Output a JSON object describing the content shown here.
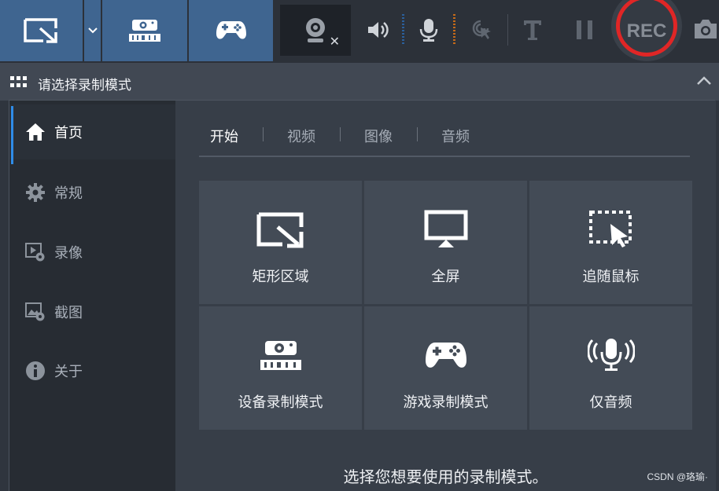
{
  "toolbar": {
    "rec_label": "REC"
  },
  "header": {
    "title": "请选择录制模式"
  },
  "sidebar": {
    "items": [
      {
        "label": "首页",
        "icon": "home-icon"
      },
      {
        "label": "常规",
        "icon": "gear-icon"
      },
      {
        "label": "录像",
        "icon": "video-settings-icon"
      },
      {
        "label": "截图",
        "icon": "image-settings-icon"
      },
      {
        "label": "关于",
        "icon": "info-icon"
      }
    ]
  },
  "tabs": [
    {
      "label": "开始"
    },
    {
      "label": "视频"
    },
    {
      "label": "图像"
    },
    {
      "label": "音频"
    }
  ],
  "tiles": [
    {
      "label": "矩形区域",
      "icon": "rectangle-area-icon"
    },
    {
      "label": "全屏",
      "icon": "monitor-icon"
    },
    {
      "label": "追随鼠标",
      "icon": "follow-cursor-icon"
    },
    {
      "label": "设备录制模式",
      "icon": "hdmi-icon"
    },
    {
      "label": "游戏录制模式",
      "icon": "gamepad-icon"
    },
    {
      "label": "仅音频",
      "icon": "microphone-icon"
    }
  ],
  "hint": "选择您想要使用的录制模式。",
  "watermark": "CSDN @珞瑜·",
  "colors": {
    "accent": "#2f8ce8",
    "mode_button": "#3f6590",
    "rec_ring": "#e02626"
  }
}
